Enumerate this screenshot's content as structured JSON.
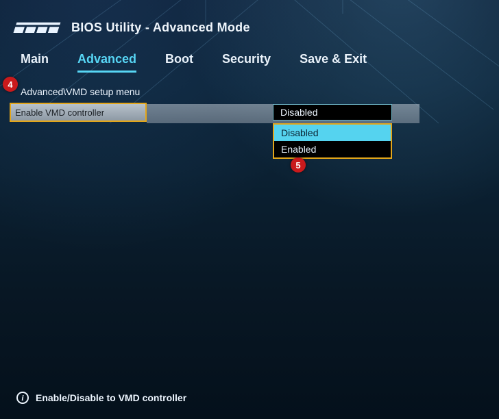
{
  "header": {
    "brand": "ASUS",
    "title": "BIOS Utility - Advanced Mode"
  },
  "tabs": {
    "items": [
      {
        "label": "Main"
      },
      {
        "label": "Advanced"
      },
      {
        "label": "Boot"
      },
      {
        "label": "Security"
      },
      {
        "label": "Save & Exit"
      }
    ],
    "active_index": 1
  },
  "breadcrumb": "Advanced\\VMD setup menu",
  "setting": {
    "label": "Enable VMD controller",
    "current_value": "Disabled",
    "options": [
      {
        "label": "Disabled",
        "selected": true
      },
      {
        "label": "Enabled",
        "selected": false
      }
    ]
  },
  "annotations": {
    "step4": "4",
    "step5": "5"
  },
  "help": {
    "text": "Enable/Disable to VMD controller"
  }
}
